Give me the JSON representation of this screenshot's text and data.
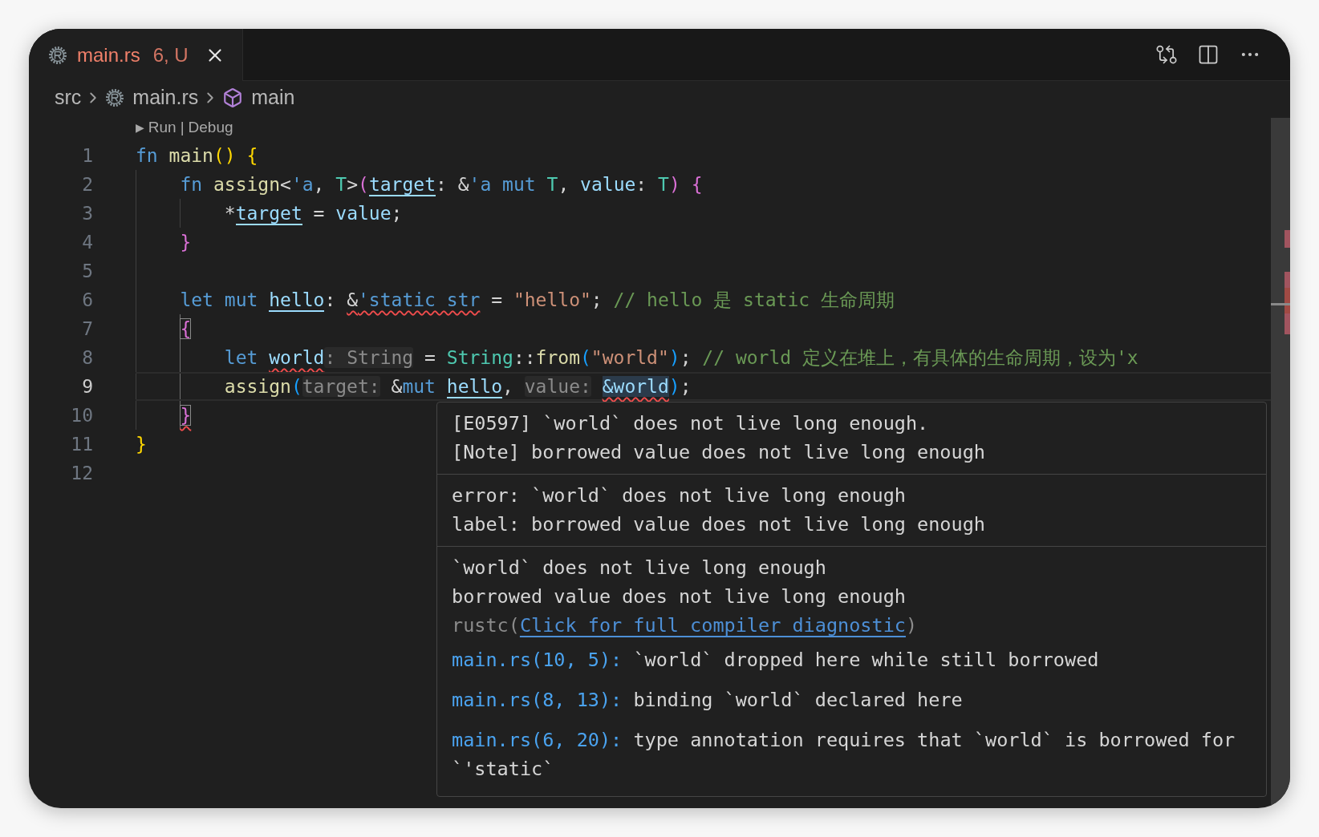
{
  "tab": {
    "title": "main.rs",
    "badge": "6, U",
    "selected": true
  },
  "breadcrumbs": [
    {
      "label": "src",
      "kind": "folder"
    },
    {
      "label": "main.rs",
      "kind": "file"
    },
    {
      "label": "main",
      "kind": "symbol"
    }
  ],
  "codelens": {
    "glyph": "▶",
    "actions": [
      "Run",
      "Debug"
    ],
    "separator": "|"
  },
  "lines": [
    {
      "number": "1",
      "current": false,
      "tokens": [
        {
          "text": "fn ",
          "kind": "keyword"
        },
        {
          "text": "main",
          "kind": "function"
        },
        {
          "text": "() ",
          "kind": "bracket",
          "color": "#ffd700"
        },
        {
          "text": "{",
          "kind": "bracket",
          "color": "#ffd700"
        }
      ]
    },
    {
      "number": "2",
      "current": false,
      "tokens": [
        {
          "text": "    fn ",
          "kind": "keyword"
        },
        {
          "text": "assign",
          "kind": "function"
        },
        {
          "text": "<",
          "kind": "punct"
        },
        {
          "text": "'a",
          "kind": "lifetime"
        },
        {
          "text": ", ",
          "kind": "punct"
        },
        {
          "text": "T",
          "kind": "type"
        },
        {
          "text": ">",
          "kind": "punct"
        },
        {
          "text": "(",
          "kind": "bracket",
          "color": "#da70d6"
        },
        {
          "text": "target",
          "kind": "variable",
          "underline": true
        },
        {
          "text": ": &",
          "kind": "punct"
        },
        {
          "text": "'a",
          "kind": "lifetime"
        },
        {
          "text": " mut ",
          "kind": "keyword"
        },
        {
          "text": "T",
          "kind": "type"
        },
        {
          "text": ", ",
          "kind": "punct"
        },
        {
          "text": "value",
          "kind": "variable"
        },
        {
          "text": ": ",
          "kind": "punct"
        },
        {
          "text": "T",
          "kind": "type"
        },
        {
          "text": ") ",
          "kind": "bracket",
          "color": "#da70d6"
        },
        {
          "text": "{",
          "kind": "bracket",
          "color": "#da70d6"
        }
      ]
    },
    {
      "number": "3",
      "current": false,
      "tokens": [
        {
          "text": "        *",
          "kind": "punct"
        },
        {
          "text": "target",
          "kind": "variable",
          "underline": true
        },
        {
          "text": " = ",
          "kind": "punct"
        },
        {
          "text": "value",
          "kind": "variable"
        },
        {
          "text": ";",
          "kind": "punct"
        }
      ]
    },
    {
      "number": "4",
      "current": false,
      "tokens": [
        {
          "text": "    }",
          "kind": "bracket",
          "color": "#da70d6"
        }
      ]
    },
    {
      "number": "5",
      "current": false
    },
    {
      "number": "6",
      "current": false,
      "tokens": [
        {
          "text": "    let mut ",
          "kind": "keyword"
        },
        {
          "text": "hello",
          "kind": "variable",
          "underline": true
        },
        {
          "text": ": ",
          "kind": "punct"
        },
        {
          "text": "&",
          "kind": "punct",
          "squiggle": true
        },
        {
          "text": "'static str",
          "kind": "lifetime",
          "squiggle": true
        },
        {
          "text": " = ",
          "kind": "punct"
        },
        {
          "text": "\"hello\"",
          "kind": "string"
        },
        {
          "text": "; ",
          "kind": "punct"
        },
        {
          "text": "// hello 是 static 生命周期",
          "kind": "comment"
        }
      ]
    },
    {
      "number": "7",
      "current": false,
      "tokens": [
        {
          "text": "    {",
          "kind": "bracket",
          "color": "#da70d6",
          "matched": true
        }
      ]
    },
    {
      "number": "8",
      "current": false,
      "tokens": [
        {
          "text": "        let ",
          "kind": "keyword"
        },
        {
          "text": "world",
          "kind": "variable",
          "squiggle": true
        },
        {
          "text": ": String",
          "kind": "hint"
        },
        {
          "text": " = ",
          "kind": "punct"
        },
        {
          "text": "String",
          "kind": "type"
        },
        {
          "text": "::",
          "kind": "punct"
        },
        {
          "text": "from",
          "kind": "function"
        },
        {
          "text": "(",
          "kind": "bracket",
          "color": "#179fff"
        },
        {
          "text": "\"world\"",
          "kind": "string"
        },
        {
          "text": ")",
          "kind": "bracket",
          "color": "#179fff"
        },
        {
          "text": "; ",
          "kind": "punct"
        },
        {
          "text": "// world 定义在堆上，有具体的生命周期，设为'x",
          "kind": "comment"
        }
      ]
    },
    {
      "number": "9",
      "current": true,
      "tokens": [
        {
          "text": "        assign",
          "kind": "function"
        },
        {
          "text": "(",
          "kind": "bracket",
          "color": "#179fff"
        },
        {
          "text": "target:",
          "kind": "hint"
        },
        {
          "text": " &",
          "kind": "punct"
        },
        {
          "text": "mut ",
          "kind": "keyword"
        },
        {
          "text": "hello",
          "kind": "variable",
          "underline": true
        },
        {
          "text": ", ",
          "kind": "punct"
        },
        {
          "text": "value: ",
          "kind": "hint"
        },
        {
          "text": "&world",
          "kind": "variable",
          "squiggle": true,
          "highlight": true
        },
        {
          "text": ")",
          "kind": "bracket",
          "color": "#179fff"
        },
        {
          "text": ";",
          "kind": "punct"
        }
      ]
    },
    {
      "number": "10",
      "current": false,
      "tokens": [
        {
          "text": "    }",
          "kind": "bracket",
          "color": "#da70d6",
          "matched": true,
          "squiggle": true
        }
      ]
    },
    {
      "number": "11",
      "current": false,
      "tokens": [
        {
          "text": "}",
          "kind": "bracket",
          "color": "#ffd700"
        }
      ]
    },
    {
      "number": "12",
      "current": false
    }
  ],
  "hover": {
    "sections": [
      {
        "lines": [
          "[E0597] `world` does not live long enough.",
          "[Note] borrowed value does not live long enough"
        ]
      },
      {
        "lines": [
          "error: `world` does not live long enough",
          "label: borrowed value does not live long enough"
        ]
      },
      {
        "lines": [
          "`world` does not live long enough",
          "borrowed value does not live long enough"
        ],
        "source_open": "rustc(",
        "link": "Click for full compiler diagnostic",
        "source_close": ")"
      }
    ],
    "related": [
      {
        "location": "main.rs(10, 5):",
        "message": "`world` dropped here while still borrowed"
      },
      {
        "location": "main.rs(8, 13):",
        "message": "binding `world` declared here"
      },
      {
        "location": "main.rs(6, 20):",
        "message": "type annotation requires that `world` is borrowed for `'static`"
      }
    ]
  }
}
